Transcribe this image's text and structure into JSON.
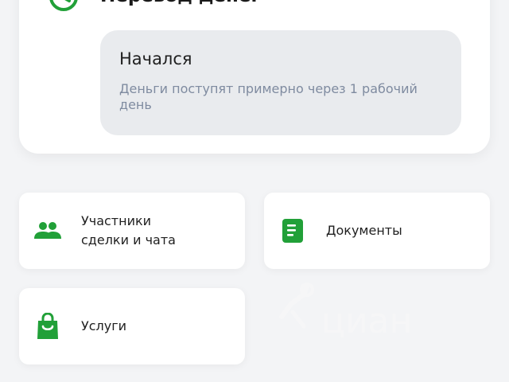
{
  "transfer": {
    "title": "Перевод денег",
    "status": {
      "title": "Начался",
      "description": "Деньги поступят примерно через 1 рабочий день"
    }
  },
  "tiles": {
    "participants": {
      "label": "Участники\nсделки и чата",
      "icon": "people-icon"
    },
    "documents": {
      "label": "Документы",
      "icon": "document-icon"
    },
    "services": {
      "label": "Услуги",
      "icon": "shopping-bag-icon"
    }
  },
  "watermark": {
    "text": "циан"
  },
  "colors": {
    "accent": "#21a038",
    "status_bg": "#e9ebee",
    "secondary_text": "#7f8ba0"
  }
}
